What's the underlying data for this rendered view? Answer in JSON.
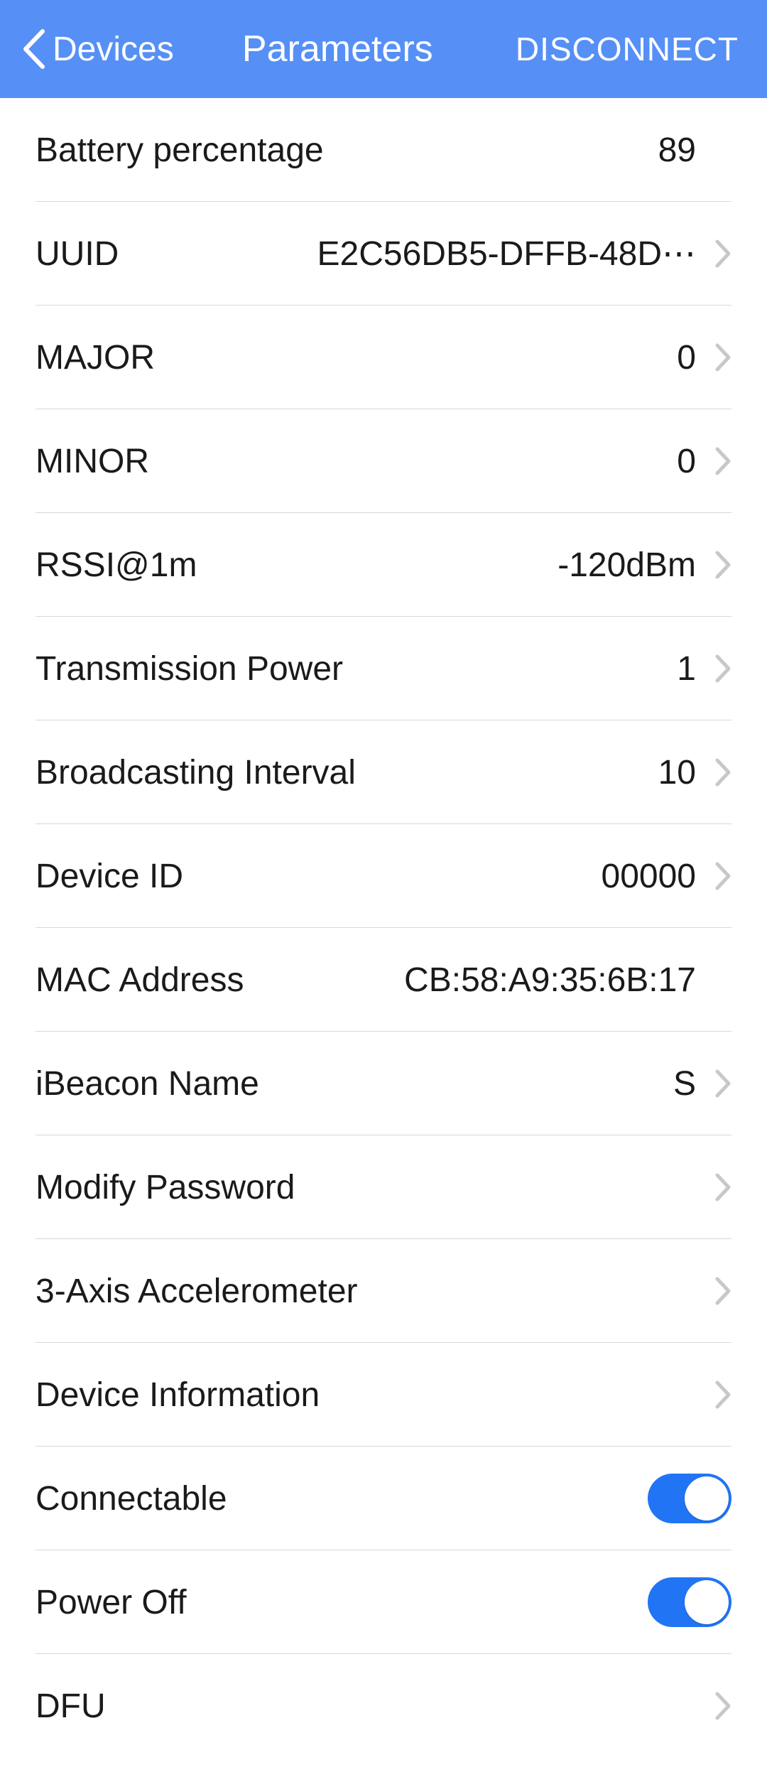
{
  "header": {
    "back_label": "Devices",
    "title": "Parameters",
    "disconnect_label": "DISCONNECT"
  },
  "rows": {
    "battery": {
      "label": "Battery percentage",
      "value": "89"
    },
    "uuid": {
      "label": "UUID",
      "value": "E2C56DB5-DFFB-48D⋯"
    },
    "major": {
      "label": "MAJOR",
      "value": "0"
    },
    "minor": {
      "label": "MINOR",
      "value": "0"
    },
    "rssi": {
      "label": "RSSI@1m",
      "value": "-120dBm"
    },
    "txpower": {
      "label": "Transmission Power",
      "value": "1"
    },
    "interval": {
      "label": "Broadcasting Interval",
      "value": "10"
    },
    "deviceid": {
      "label": "Device ID",
      "value": "00000"
    },
    "mac": {
      "label": "MAC Address",
      "value": "CB:58:A9:35:6B:17"
    },
    "name": {
      "label": "iBeacon Name",
      "value": "S"
    },
    "password": {
      "label": "Modify Password",
      "value": ""
    },
    "accel": {
      "label": "3-Axis Accelerometer",
      "value": ""
    },
    "devinfo": {
      "label": "Device Information",
      "value": ""
    },
    "connect": {
      "label": "Connectable"
    },
    "poweroff": {
      "label": "Power Off"
    },
    "dfu": {
      "label": "DFU",
      "value": ""
    }
  },
  "toggles": {
    "connectable": true,
    "power_off": true
  }
}
